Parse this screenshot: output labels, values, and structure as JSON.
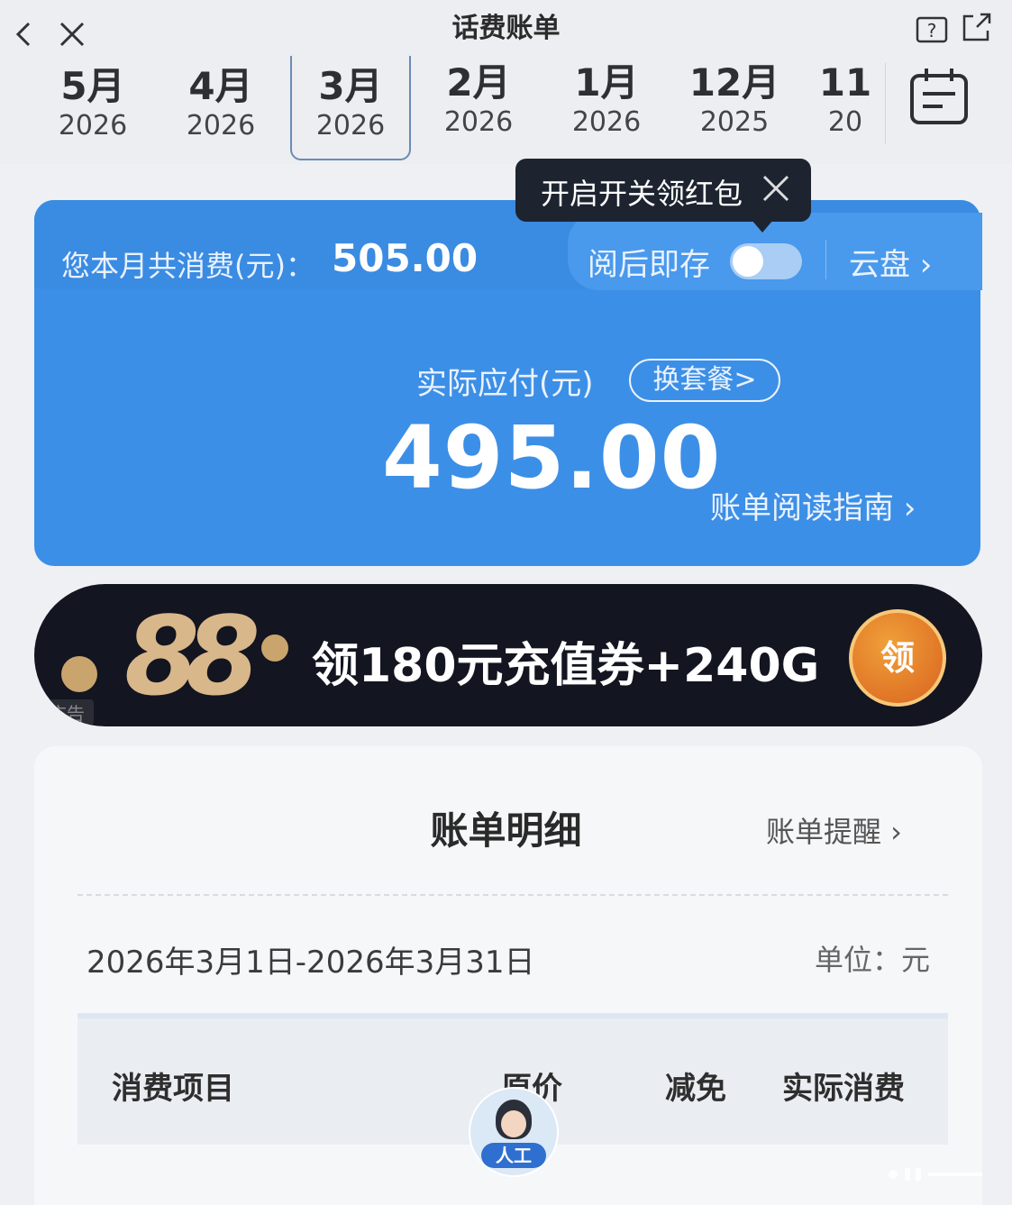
{
  "header": {
    "title": "话费账单"
  },
  "months": [
    {
      "month": "5月",
      "year": "2026"
    },
    {
      "month": "4月",
      "year": "2026"
    },
    {
      "month": "3月",
      "year": "2026",
      "selected": true
    },
    {
      "month": "2月",
      "year": "2026"
    },
    {
      "month": "1月",
      "year": "2026"
    },
    {
      "month": "12月",
      "year": "2025"
    },
    {
      "month": "11",
      "year": "20"
    }
  ],
  "tooltip": {
    "text": "开启开关领红包"
  },
  "summary": {
    "spend_label": "您本月共消费(元)：",
    "spend_value": "505.00",
    "save_label": "阅后即存",
    "save_toggle_on": false,
    "cloud_link": "云盘 ›",
    "pay_label": "实际应付(元)",
    "plan_button": "换套餐>",
    "pay_value": "495.00",
    "guide_link": "账单阅读指南 ›"
  },
  "ad": {
    "badge": "88",
    "text": "领180元充值券+240G",
    "button": "领",
    "tag": "广告"
  },
  "detail": {
    "title": "账单明细",
    "remind_link": "账单提醒 ›",
    "period": "2026年3月1日-2026年3月31日",
    "unit": "单位：元",
    "columns": [
      "消费项目",
      "原价",
      "减免",
      "实际消费"
    ]
  },
  "service": {
    "label": "人工"
  },
  "colors": {
    "card_blue": "#3c8fe6",
    "ad_bg": "#131520",
    "page_bg": "#eef0f3"
  }
}
